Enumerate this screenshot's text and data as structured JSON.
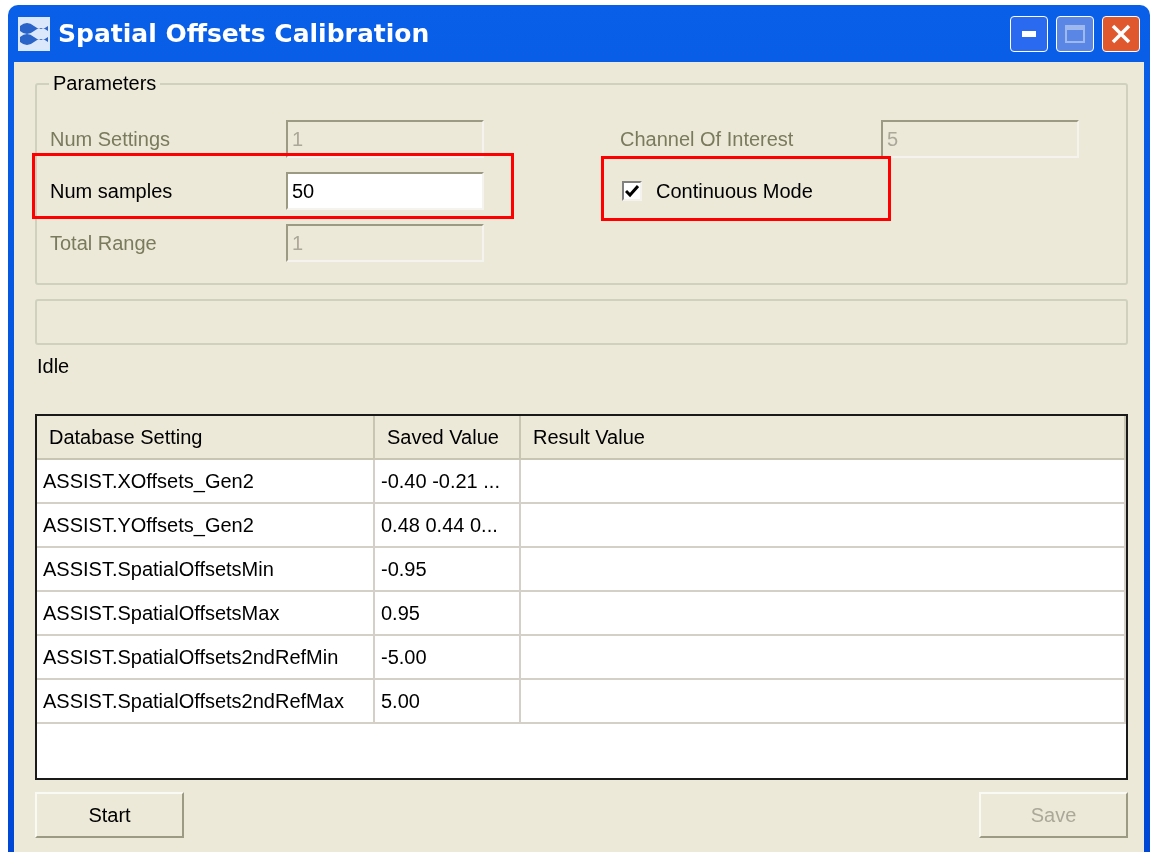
{
  "window": {
    "title": "Spatial Offsets Calibration"
  },
  "parameters": {
    "title": "Parameters",
    "left": [
      {
        "kind": "field",
        "label": "Num Settings",
        "value": "1",
        "disabled": true,
        "highlighted": false
      },
      {
        "kind": "field",
        "label": "Num samples",
        "value": "50",
        "disabled": false,
        "highlighted": true
      },
      {
        "kind": "field",
        "label": "Total Range",
        "value": "1",
        "disabled": true,
        "highlighted": false
      }
    ],
    "right": [
      {
        "kind": "field",
        "label": "Channel Of Interest",
        "value": "5",
        "disabled": true,
        "highlighted": false
      },
      {
        "kind": "checkbox",
        "label": "Continuous Mode",
        "checked": true,
        "highlighted": true
      }
    ]
  },
  "status": "Idle",
  "table": {
    "columns": [
      "Database Setting",
      "Saved Value",
      "Result Value"
    ],
    "rows": [
      [
        "ASSIST.XOffsets_Gen2",
        "-0.40 -0.21 ..."
      ],
      [
        "ASSIST.YOffsets_Gen2",
        "0.48 0.44 0..."
      ],
      [
        "ASSIST.SpatialOffsetsMin",
        "-0.95"
      ],
      [
        "ASSIST.SpatialOffsetsMax",
        "0.95"
      ],
      [
        "ASSIST.SpatialOffsets2ndRefMin",
        "-5.00"
      ],
      [
        "ASSIST.SpatialOffsets2ndRefMax",
        "5.00"
      ]
    ]
  },
  "buttons": [
    {
      "label": "Start",
      "disabled": false
    },
    {
      "label": "Save",
      "disabled": true
    }
  ]
}
